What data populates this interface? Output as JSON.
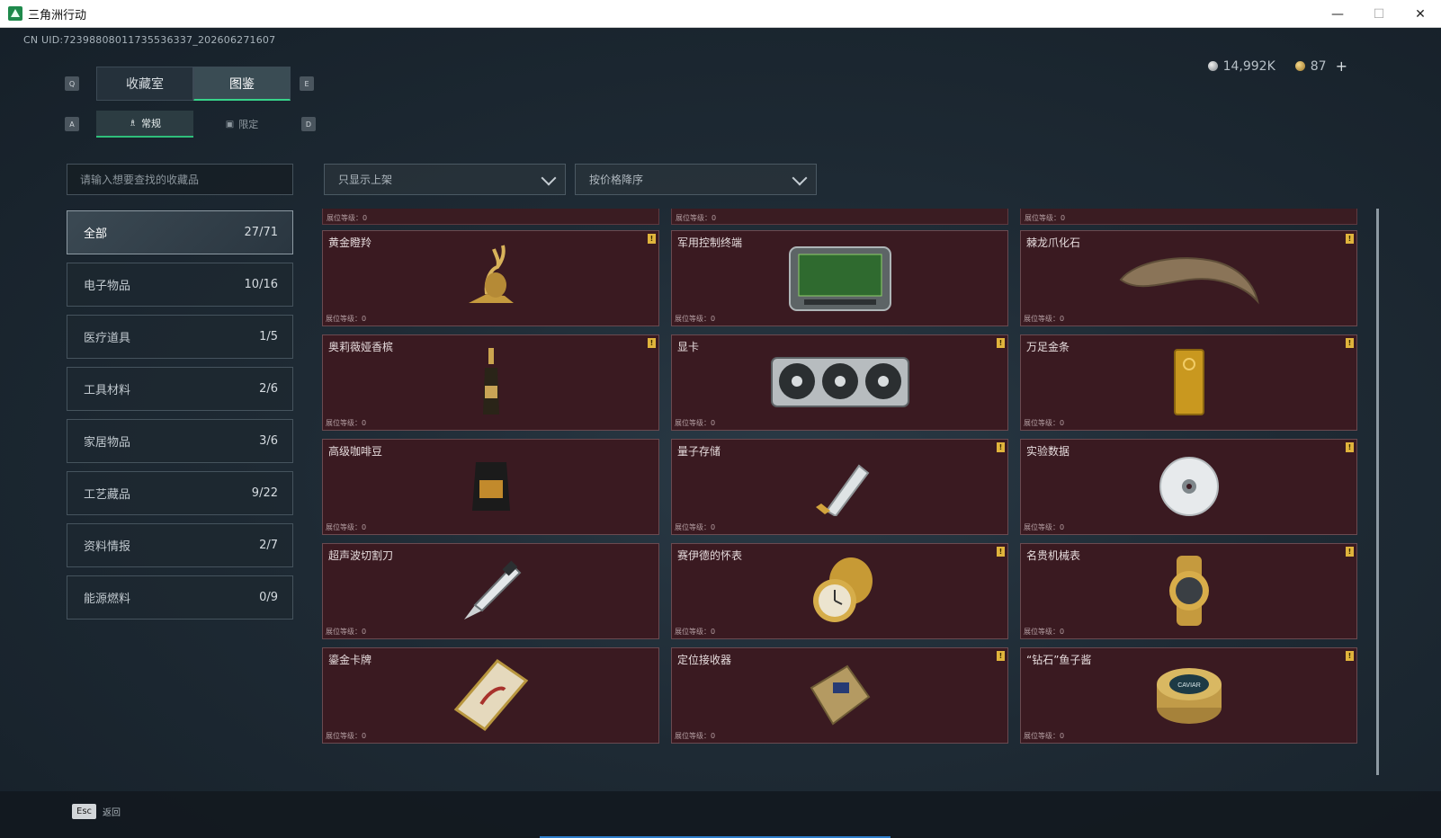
{
  "window": {
    "title": "三角洲行动",
    "minimize": "—",
    "maximize": "☐",
    "close": "✕"
  },
  "uid": "CN UID:723988080117355363​37_202606271607",
  "currency": {
    "silver": "14,992K",
    "gold": "87",
    "plus": "+"
  },
  "keys": {
    "q": "Q",
    "e": "E",
    "a": "A",
    "d": "D"
  },
  "main_tabs": [
    {
      "label": "收藏室"
    },
    {
      "label": "图鉴"
    }
  ],
  "sub_tabs": [
    {
      "label": "常规",
      "icon": "♗"
    },
    {
      "label": "限定",
      "icon": "▣"
    }
  ],
  "search": {
    "placeholder": "请输入想要查找的收藏品"
  },
  "filters": {
    "shelf": "只显示上架",
    "sort": "按价格降序"
  },
  "categories": [
    {
      "label": "全部",
      "count": "27/71"
    },
    {
      "label": "电子物品",
      "count": "10/16"
    },
    {
      "label": "医疗道具",
      "count": "1/5"
    },
    {
      "label": "工具材料",
      "count": "2/6"
    },
    {
      "label": "家居物品",
      "count": "3/6"
    },
    {
      "label": "工艺藏品",
      "count": "9/22"
    },
    {
      "label": "资料情报",
      "count": "2/7"
    },
    {
      "label": "能源燃料",
      "count": "0/9"
    }
  ],
  "level_label": "展位等级：0",
  "badge": "!",
  "items": [
    {
      "name": "黄金瞪羚",
      "icon": "gold-gazelle-icon",
      "badge": true
    },
    {
      "name": "军用控制终端",
      "icon": "military-terminal-icon",
      "badge": false
    },
    {
      "name": "棘龙爪化石",
      "icon": "dinosaur-claw-icon",
      "badge": true
    },
    {
      "name": "奥莉薇娅香槟",
      "icon": "champagne-icon",
      "badge": true
    },
    {
      "name": "显卡",
      "icon": "graphics-card-icon",
      "badge": true
    },
    {
      "name": "万足金条",
      "icon": "gold-bar-icon",
      "badge": true
    },
    {
      "name": "高级咖啡豆",
      "icon": "coffee-bag-icon",
      "badge": false
    },
    {
      "name": "量子存储",
      "icon": "quantum-storage-icon",
      "badge": true
    },
    {
      "name": "实验数据",
      "icon": "data-disc-icon",
      "badge": true
    },
    {
      "name": "超声波切割刀",
      "icon": "ultrasonic-knife-icon",
      "badge": false
    },
    {
      "name": "赛伊德的怀表",
      "icon": "pocket-watch-icon",
      "badge": true
    },
    {
      "name": "名贵机械表",
      "icon": "wristwatch-icon",
      "badge": true
    },
    {
      "name": "鎏金卡牌",
      "icon": "gilded-card-icon",
      "badge": false
    },
    {
      "name": "定位接收器",
      "icon": "gps-receiver-icon",
      "badge": true
    },
    {
      "name": "“钻石”鱼子酱",
      "icon": "caviar-tin-icon",
      "badge": true
    }
  ],
  "caviar_label": "CAVIAR",
  "bottom": {
    "esc_key": "Esc",
    "back": "返回"
  }
}
